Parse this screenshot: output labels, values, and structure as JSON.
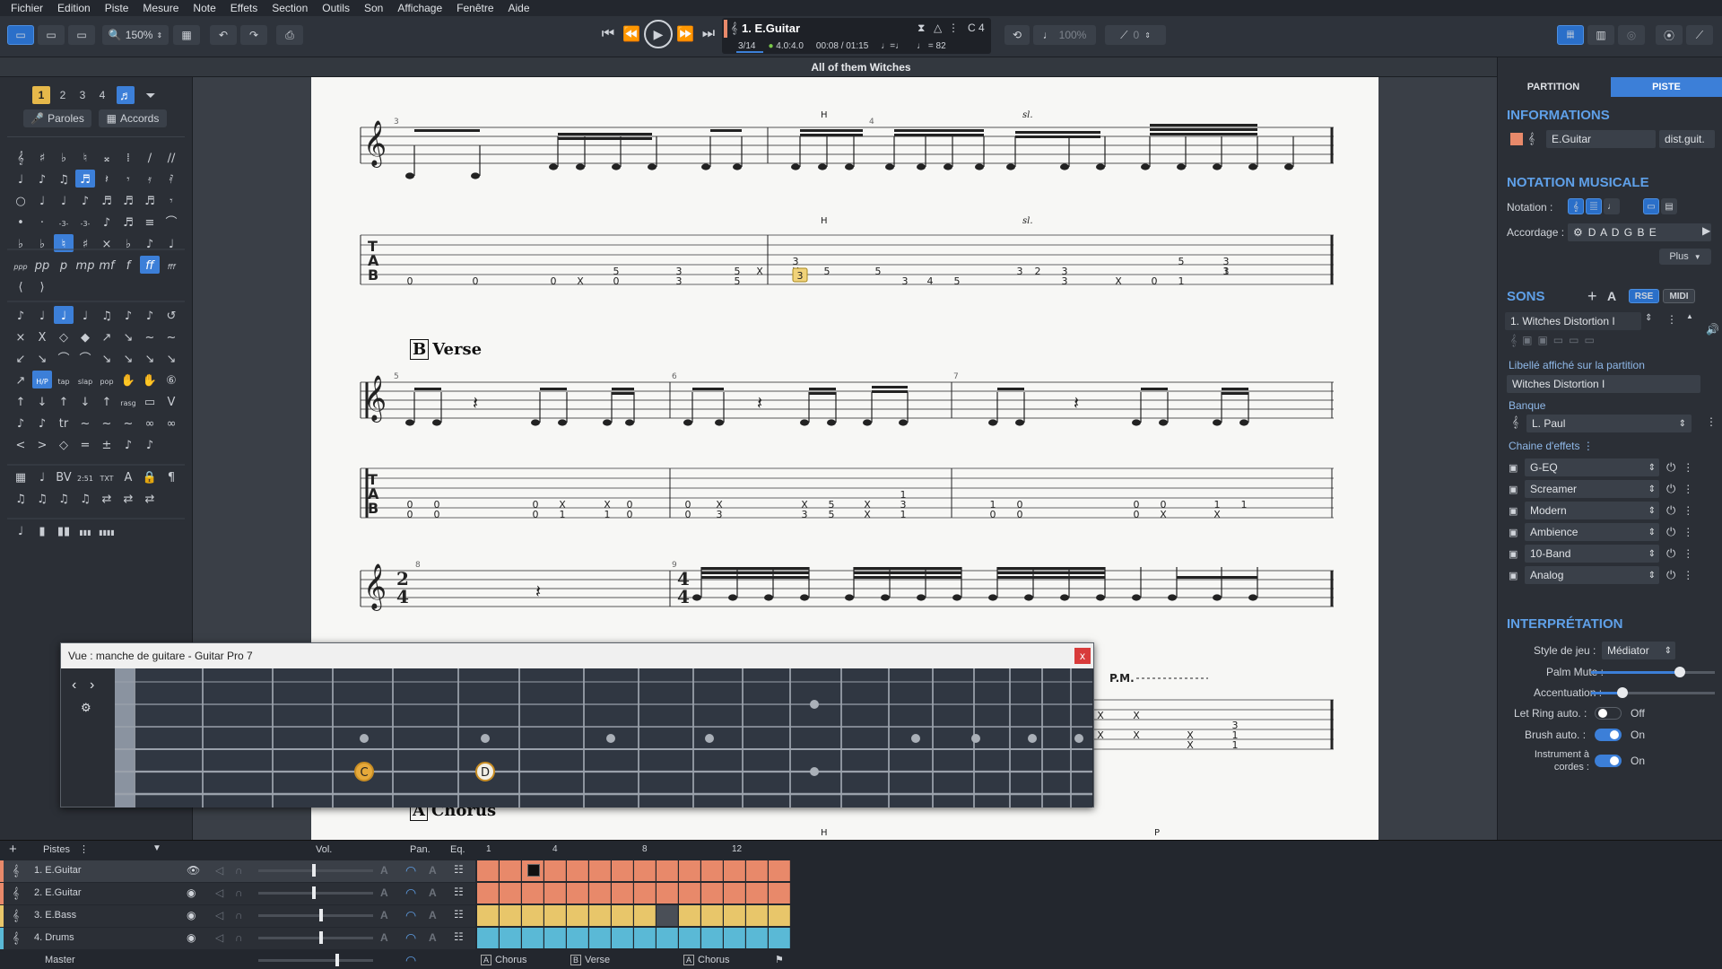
{
  "menu": [
    "Fichier",
    "Edition",
    "Piste",
    "Mesure",
    "Note",
    "Effets",
    "Section",
    "Outils",
    "Son",
    "Affichage",
    "Fenêtre",
    "Aide"
  ],
  "toolbar": {
    "zoom": "150%",
    "lcd": {
      "track": "1. E.Guitar",
      "bar": "3/14",
      "sig": "4.0:4.0",
      "time": "00:08 / 01:15",
      "tempo_label": "♩=♩",
      "tempo": "♩ = 82",
      "key": "C 4"
    },
    "volume": "100%",
    "pitch": "0"
  },
  "document": {
    "title": "All of them Witches"
  },
  "palette": {
    "voices": [
      "1",
      "2",
      "3",
      "4"
    ],
    "lyrics": "Paroles",
    "chords": "Accords"
  },
  "score": {
    "section_b": "Verse",
    "section_b_letter": "B",
    "section_a": "Chorus",
    "section_a_letter": "A",
    "bar_numbers": [
      "3",
      "4",
      "5",
      "6",
      "7",
      "8",
      "9"
    ],
    "mark_h": "H",
    "mark_sl": "sl.",
    "mark_p": "P",
    "pm": "P.M.",
    "tab_row1": [
      "0",
      "0",
      "0",
      "X",
      "0",
      "5",
      "3",
      "3",
      "5",
      "5",
      "X",
      "X",
      "3",
      "5",
      "5",
      "3",
      "4",
      "5",
      "3",
      "2",
      "3",
      "3",
      "X",
      "0",
      "1",
      "5",
      "3",
      "3",
      "1"
    ],
    "tab_row2": [
      "0",
      "0",
      "0",
      "0",
      "0",
      "0",
      "X",
      "1",
      "X",
      "1",
      "0",
      "0",
      "0",
      "0",
      "X",
      "3",
      "X",
      "3",
      "5",
      "5",
      "X",
      "X",
      "3",
      "1",
      "1",
      "0",
      "0",
      "0",
      "0",
      "0",
      "0",
      "X",
      "1",
      "X",
      "1"
    ],
    "tab_row3": [
      "X",
      "X",
      "X",
      "X",
      "X",
      "X",
      "3",
      "1",
      "1"
    ]
  },
  "fretboard": {
    "title": "Vue : manche de guitare - Guitar Pro 7",
    "close": "x",
    "notes": [
      "C",
      "D"
    ]
  },
  "right_panel": {
    "tabs": [
      "PARTITION",
      "PISTE"
    ],
    "informations": "INFORMATIONS",
    "track_name": "E.Guitar",
    "track_short": "dist.guit.",
    "notation_head": "NOTATION MUSICALE",
    "notation_label": "Notation :",
    "tuning_label": "Accordage :",
    "tuning": "D A D G B E",
    "more": "Plus",
    "sons_head": "SONS",
    "rse": "RSE",
    "midi": "MIDI",
    "sound_name": "1. Witches Distortion I",
    "label_caption": "Libellé affiché sur la partition",
    "label_value": "Witches Distortion I",
    "bank_caption": "Banque",
    "bank_value": "L. Paul",
    "fx_caption": "Chaine d'effets",
    "effects": [
      "G-EQ",
      "Screamer",
      "Modern",
      "Ambience",
      "10-Band",
      "Analog"
    ],
    "interp_head": "INTERPRÉTATION",
    "style_label": "Style de jeu :",
    "style_value": "Médiator",
    "palm_label": "Palm Mute :",
    "palm_level": 0.72,
    "accent_label": "Accentuation :",
    "accent_level": 0.25,
    "letring_label": "Let Ring auto. :",
    "letring_value": "Off",
    "brush_label": "Brush auto. :",
    "brush_value": "On",
    "strings_label": "Instrument à cordes :",
    "strings_value": "On"
  },
  "tracks": {
    "header": "Pistes",
    "vol": "Vol.",
    "pan": "Pan.",
    "eq": "Eq.",
    "list": [
      "1. E.Guitar",
      "2. E.Guitar",
      "3. E.Bass",
      "4. Drums"
    ],
    "master": "Master",
    "ruler": [
      "1",
      "4",
      "8",
      "12"
    ],
    "markers": [
      "Chorus",
      "Verse",
      "Chorus"
    ],
    "marker_letters": [
      "A",
      "B",
      "A"
    ],
    "colors": [
      "#e8896a",
      "#e8896a",
      "#e8c66a",
      "#5ab9d6"
    ]
  }
}
